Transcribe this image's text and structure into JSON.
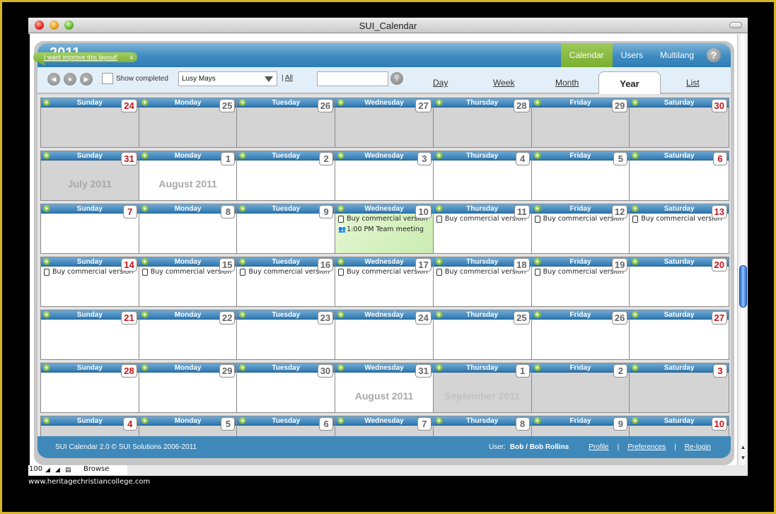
{
  "window": {
    "title": "SUI_Calendar"
  },
  "tooltip": {
    "text": "I want improve this layout!",
    "close": "x"
  },
  "header": {
    "year": "2011",
    "nav": [
      {
        "label": "Calendar",
        "active": true
      },
      {
        "label": "Users",
        "active": false
      },
      {
        "label": "Multilang",
        "active": false
      }
    ],
    "help": "?"
  },
  "toolbar": {
    "show_completed_label": "Show completed",
    "show_completed_checked": false,
    "user_select_value": "Lusy Mays",
    "all_separator": "|",
    "all_link": "All",
    "search_value": "",
    "views": [
      "Day",
      "Week",
      "Month",
      "Year",
      "List"
    ],
    "active_view": "Year"
  },
  "weeks": [
    {
      "days": [
        {
          "name": "Sunday",
          "num": "24",
          "weekend": true,
          "grey": true
        },
        {
          "name": "Monday",
          "num": "25",
          "grey": true
        },
        {
          "name": "Tuesday",
          "num": "26",
          "grey": true
        },
        {
          "name": "Wednesday",
          "num": "27",
          "grey": true
        },
        {
          "name": "Thursday",
          "num": "28",
          "grey": true
        },
        {
          "name": "Friday",
          "num": "29",
          "grey": true
        },
        {
          "name": "Saturday",
          "num": "30",
          "weekend": true,
          "grey": true
        }
      ]
    },
    {
      "days": [
        {
          "name": "Sunday",
          "num": "31",
          "weekend": true,
          "grey": true,
          "month_label": "July 2011"
        },
        {
          "name": "Monday",
          "num": "1",
          "month_label": "August 2011"
        },
        {
          "name": "Tuesday",
          "num": "2"
        },
        {
          "name": "Wednesday",
          "num": "3"
        },
        {
          "name": "Thursday",
          "num": "4"
        },
        {
          "name": "Friday",
          "num": "5"
        },
        {
          "name": "Saturday",
          "num": "6",
          "weekend": true
        }
      ]
    },
    {
      "days": [
        {
          "name": "Sunday",
          "num": "7",
          "weekend": true
        },
        {
          "name": "Monday",
          "num": "8"
        },
        {
          "name": "Tuesday",
          "num": "9"
        },
        {
          "name": "Wednesday",
          "num": "10",
          "today": true,
          "events": [
            {
              "type": "task",
              "text": "Buy commercial version"
            },
            {
              "type": "meeting",
              "text": "1:00 PM Team meeting"
            }
          ]
        },
        {
          "name": "Thursday",
          "num": "11",
          "events": [
            {
              "type": "task",
              "text": "Buy commercial version"
            }
          ]
        },
        {
          "name": "Friday",
          "num": "12",
          "events": [
            {
              "type": "task",
              "text": "Buy commercial version"
            }
          ]
        },
        {
          "name": "Saturday",
          "num": "13",
          "weekend": true,
          "events": [
            {
              "type": "task",
              "text": "Buy commercial version"
            }
          ]
        }
      ]
    },
    {
      "days": [
        {
          "name": "Sunday",
          "num": "14",
          "weekend": true,
          "events": [
            {
              "type": "task",
              "text": "Buy commercial version"
            }
          ]
        },
        {
          "name": "Monday",
          "num": "15",
          "events": [
            {
              "type": "task",
              "text": "Buy commercial version"
            }
          ]
        },
        {
          "name": "Tuesday",
          "num": "16",
          "events": [
            {
              "type": "task",
              "text": "Buy commercial version"
            }
          ]
        },
        {
          "name": "Wednesday",
          "num": "17",
          "events": [
            {
              "type": "task",
              "text": "Buy commercial version"
            }
          ]
        },
        {
          "name": "Thursday",
          "num": "18",
          "events": [
            {
              "type": "task",
              "text": "Buy commercial version"
            }
          ]
        },
        {
          "name": "Friday",
          "num": "19",
          "events": [
            {
              "type": "task",
              "text": "Buy commercial version"
            }
          ]
        },
        {
          "name": "Saturday",
          "num": "20",
          "weekend": true
        }
      ]
    },
    {
      "days": [
        {
          "name": "Sunday",
          "num": "21",
          "weekend": true
        },
        {
          "name": "Monday",
          "num": "22"
        },
        {
          "name": "Tuesday",
          "num": "23"
        },
        {
          "name": "Wednesday",
          "num": "24"
        },
        {
          "name": "Thursday",
          "num": "25"
        },
        {
          "name": "Friday",
          "num": "26"
        },
        {
          "name": "Saturday",
          "num": "27",
          "weekend": true
        }
      ]
    },
    {
      "days": [
        {
          "name": "Sunday",
          "num": "28",
          "weekend": true
        },
        {
          "name": "Monday",
          "num": "29"
        },
        {
          "name": "Tuesday",
          "num": "30"
        },
        {
          "name": "Wednesday",
          "num": "31",
          "month_label": "August 2011"
        },
        {
          "name": "Thursday",
          "num": "1",
          "grey": true,
          "month_label": "September 2011",
          "light": true
        },
        {
          "name": "Friday",
          "num": "2",
          "grey": true
        },
        {
          "name": "Saturday",
          "num": "3",
          "weekend": true,
          "grey": true
        }
      ]
    },
    {
      "days": [
        {
          "name": "Sunday",
          "num": "4",
          "weekend": true,
          "grey": true
        },
        {
          "name": "Monday",
          "num": "5",
          "grey": true
        },
        {
          "name": "Tuesday",
          "num": "6",
          "grey": true
        },
        {
          "name": "Wednesday",
          "num": "7",
          "grey": true
        },
        {
          "name": "Thursday",
          "num": "8",
          "grey": true
        },
        {
          "name": "Friday",
          "num": "9",
          "grey": true
        },
        {
          "name": "Saturday",
          "num": "10",
          "weekend": true,
          "grey": true
        }
      ]
    }
  ],
  "footer": {
    "copyright": "SUI Calendar 2.0 © SUI Solutions 2006-2011",
    "user_label": "User:",
    "user_name": "Bob / Bob Rollins",
    "links": [
      "Profile",
      "Preferences",
      "Re-login"
    ],
    "separator": "|"
  },
  "statusbar": {
    "zoom": "100",
    "mode": "Browse"
  },
  "watermark": "www.heritagechristiancollege.com",
  "colors": {
    "accent_blue": "#3f88ba",
    "nav_active_green": "#8bbd45",
    "weekend_red": "#c8141c",
    "today_green": "#d6f1c0"
  }
}
